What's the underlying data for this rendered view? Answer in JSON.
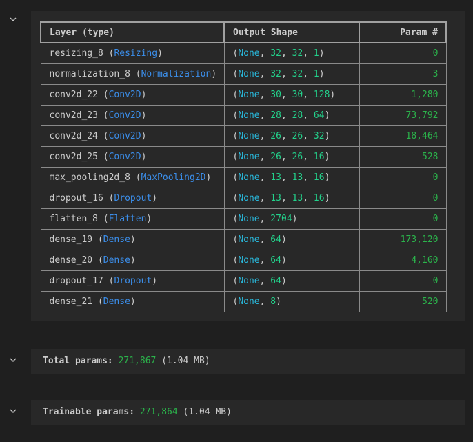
{
  "summary_table": {
    "headers": [
      "Layer (type)",
      "Output Shape",
      "Param #"
    ],
    "rows": [
      {
        "name": "resizing_8",
        "type": "Resizing",
        "shape": [
          "None",
          "32",
          "32",
          "1"
        ],
        "params": "0"
      },
      {
        "name": "normalization_8",
        "type": "Normalization",
        "shape": [
          "None",
          "32",
          "32",
          "1"
        ],
        "params": "3"
      },
      {
        "name": "conv2d_22",
        "type": "Conv2D",
        "shape": [
          "None",
          "30",
          "30",
          "128"
        ],
        "params": "1,280"
      },
      {
        "name": "conv2d_23",
        "type": "Conv2D",
        "shape": [
          "None",
          "28",
          "28",
          "64"
        ],
        "params": "73,792"
      },
      {
        "name": "conv2d_24",
        "type": "Conv2D",
        "shape": [
          "None",
          "26",
          "26",
          "32"
        ],
        "params": "18,464"
      },
      {
        "name": "conv2d_25",
        "type": "Conv2D",
        "shape": [
          "None",
          "26",
          "26",
          "16"
        ],
        "params": "528"
      },
      {
        "name": "max_pooling2d_8",
        "type": "MaxPooling2D",
        "shape": [
          "None",
          "13",
          "13",
          "16"
        ],
        "params": "0"
      },
      {
        "name": "dropout_16",
        "type": "Dropout",
        "shape": [
          "None",
          "13",
          "13",
          "16"
        ],
        "params": "0"
      },
      {
        "name": "flatten_8",
        "type": "Flatten",
        "shape": [
          "None",
          "2704"
        ],
        "params": "0"
      },
      {
        "name": "dense_19",
        "type": "Dense",
        "shape": [
          "None",
          "64"
        ],
        "params": "173,120"
      },
      {
        "name": "dense_20",
        "type": "Dense",
        "shape": [
          "None",
          "64"
        ],
        "params": "4,160"
      },
      {
        "name": "dropout_17",
        "type": "Dropout",
        "shape": [
          "None",
          "64"
        ],
        "params": "0"
      },
      {
        "name": "dense_21",
        "type": "Dense",
        "shape": [
          "None",
          "8"
        ],
        "params": "520"
      }
    ]
  },
  "total_params": {
    "label": "Total params:",
    "value": "271,867",
    "size": "(1.04 MB)"
  },
  "trainable_params": {
    "label": "Trainable params:",
    "value": "271,864",
    "size": "(1.04 MB)"
  },
  "icons": {
    "collapse": "chevron-down-icon"
  },
  "colors": {
    "background": "#1f1f1f",
    "output_background": "#282828",
    "class_name": "#3b8eea",
    "none_keyword": "#29b8db",
    "number": "#23d18b",
    "param_value": "#2bb34b"
  }
}
